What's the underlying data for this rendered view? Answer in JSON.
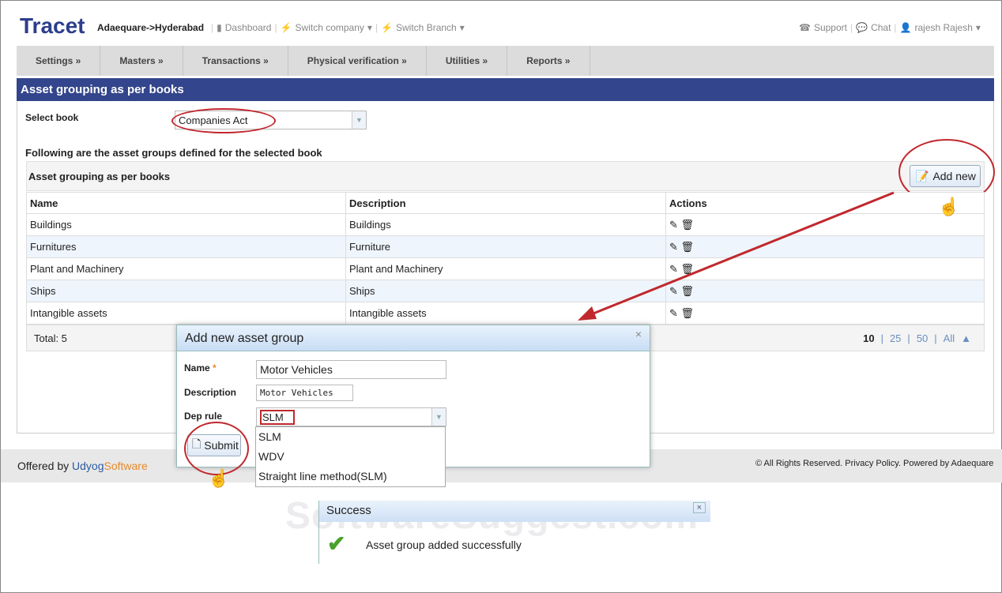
{
  "header": {
    "logo": "Tracet",
    "breadcrumb": "Adaequare->Hyderabad",
    "dashboard": "Dashboard",
    "switch_company": "Switch company",
    "switch_branch": "Switch Branch",
    "support": "Support",
    "chat": "Chat",
    "user": "rajesh Rajesh"
  },
  "nav": [
    "Settings »",
    "Masters »",
    "Transactions »",
    "Physical verification »",
    "Utilities »",
    "Reports »"
  ],
  "page": {
    "title": "Asset grouping as per books",
    "select_book_label": "Select book",
    "select_book_value": "Companies Act",
    "intro": "Following are the asset groups defined for the selected book",
    "grid_title": "Asset grouping as per books",
    "add_new": "Add new"
  },
  "table": {
    "headers": [
      "Name",
      "Description",
      "Actions"
    ],
    "rows": [
      [
        "Buildings",
        "Buildings"
      ],
      [
        "Furnitures",
        "Furniture"
      ],
      [
        "Plant and Machinery",
        "Plant and Machinery"
      ],
      [
        "Ships",
        "Ships"
      ],
      [
        "Intangible assets",
        "Intangible assets"
      ]
    ],
    "total": "Total: 5",
    "page_sizes": [
      "10",
      "25",
      "50",
      "All"
    ]
  },
  "modal": {
    "title": "Add new asset group",
    "close": "×",
    "name_label": "Name",
    "required": "*",
    "name_value": "Motor Vehicles",
    "desc_label": "Description",
    "desc_value": "Motor Vehicles",
    "dep_label": "Dep rule",
    "dep_value": "SLM",
    "options": [
      "SLM",
      "WDV",
      "Straight line method(SLM)"
    ],
    "submit": "Submit"
  },
  "footer": {
    "offered_by": "Offered by ",
    "brand1": "Udyog",
    "brand2": "Software",
    "rights": "© All Rights Reserved.  Privacy Policy.  Powered by Adaequare"
  },
  "success": {
    "title": "Success",
    "close": "×",
    "message": "Asset group added successfully"
  },
  "watermark": "SoftwareSuggest.com"
}
